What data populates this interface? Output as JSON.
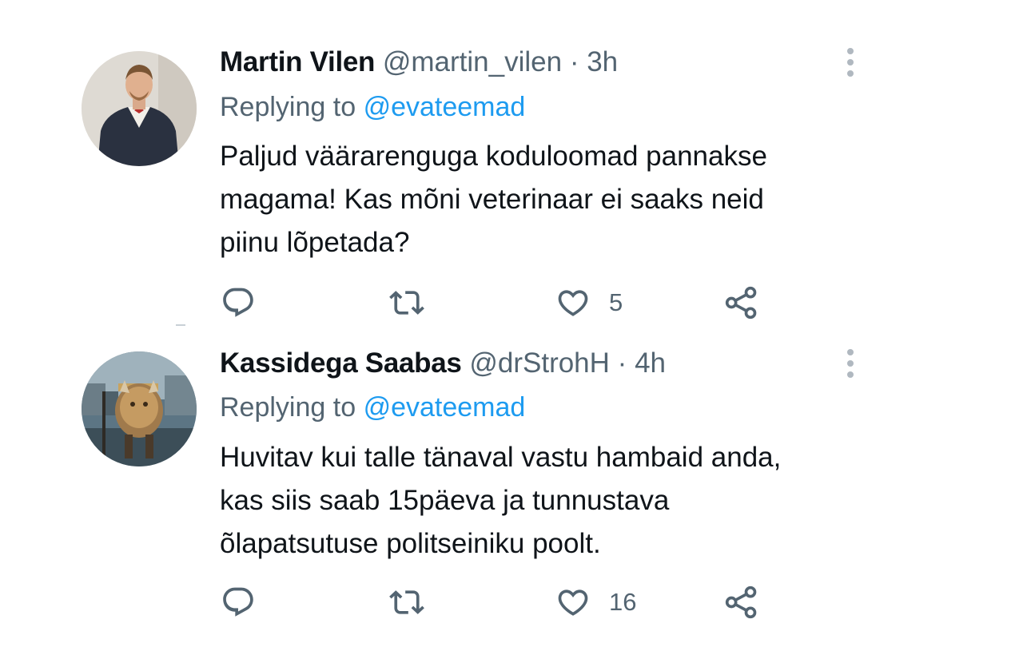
{
  "tweets": [
    {
      "author_name": "Martin Vilen",
      "author_handle": "@martin_vilen",
      "separator": "·",
      "time": "3h",
      "replying_prefix": "Replying to",
      "replying_to": "@evateemad",
      "body_lines": [
        "Paljud väärarenguga koduloomad pannakse",
        "magama! Kas mõni veterinaar ei saaks neid",
        "piinu lõpetada?"
      ],
      "like_count": "5",
      "icons": {
        "more": "more-vertical-icon",
        "reply": "reply-icon",
        "retweet": "retweet-icon",
        "like": "heart-icon",
        "share": "share-icon"
      }
    },
    {
      "author_name": "Kassidega Saabas",
      "author_handle": "@drStrohH",
      "separator": "·",
      "time": "4h",
      "replying_prefix": "Replying to",
      "replying_to": "@evateemad",
      "body_lines": [
        "Huvitav kui talle tänaval vastu hambaid anda,",
        "kas siis saab 15päeva ja tunnustava",
        "õlapatsutuse politseiniku poolt."
      ],
      "like_count": "16",
      "icons": {
        "more": "more-vertical-icon",
        "reply": "reply-icon",
        "retweet": "retweet-icon",
        "like": "heart-icon",
        "share": "share-icon"
      }
    }
  ],
  "colors": {
    "text_primary": "#0f1419",
    "text_secondary": "#536471",
    "accent": "#1d9bf0"
  }
}
